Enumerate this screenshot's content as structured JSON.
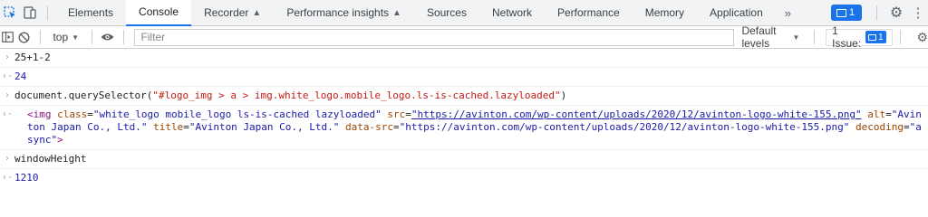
{
  "tabs": [
    {
      "label": "Elements",
      "flask": false
    },
    {
      "label": "Console",
      "flask": false,
      "active": true
    },
    {
      "label": "Recorder",
      "flask": true
    },
    {
      "label": "Performance insights",
      "flask": true
    },
    {
      "label": "Sources",
      "flask": false
    },
    {
      "label": "Network",
      "flask": false
    },
    {
      "label": "Performance",
      "flask": false
    },
    {
      "label": "Memory",
      "flask": false
    },
    {
      "label": "Application",
      "flask": false
    }
  ],
  "tabbar": {
    "more": "»",
    "issues_count": "1"
  },
  "toolbar": {
    "context": "top",
    "filter_placeholder": "Filter",
    "levels": "Default levels",
    "issues_label": "1 Issue:",
    "issues_count": "1"
  },
  "console": {
    "e1_input": "25+1-2",
    "e1_output": "24",
    "e2_input_prefix": "document.querySelector(",
    "e2_input_string": "\"#logo_img > a > img.white_logo.mobile_logo.ls-is-cached.lazyloaded\"",
    "e2_input_suffix": ")",
    "e2_el_open": "<img",
    "e2_attr_class": "class",
    "e2_val_class": "\"white_logo mobile_logo ls-is-cached lazyloaded\"",
    "e2_attr_src": "src",
    "e2_val_src": "\"https://avinton.com/wp-content/uploads/2020/12/avinton-logo-white-155.png\"",
    "e2_attr_alt": "alt",
    "e2_val_alt": "\"Avinton Japan Co., Ltd.\"",
    "e2_attr_title": "title",
    "e2_val_title": "\"Avinton Japan Co., Ltd.\"",
    "e2_attr_datasrc": "data-src",
    "e2_val_datasrc": "\"https://avinton.com/wp-content/uploads/2020/12/avinton-logo-white-155.png\"",
    "e2_attr_decoding": "decoding",
    "e2_val_decoding": "\"async\"",
    "e2_el_close": ">",
    "e3_input": "windowHeight",
    "e3_output": "1210"
  },
  "colors": {
    "accent": "#1a73e8",
    "string": "#c41a16",
    "number": "#1a1aa6",
    "tag": "#881280",
    "attr": "#994500"
  }
}
